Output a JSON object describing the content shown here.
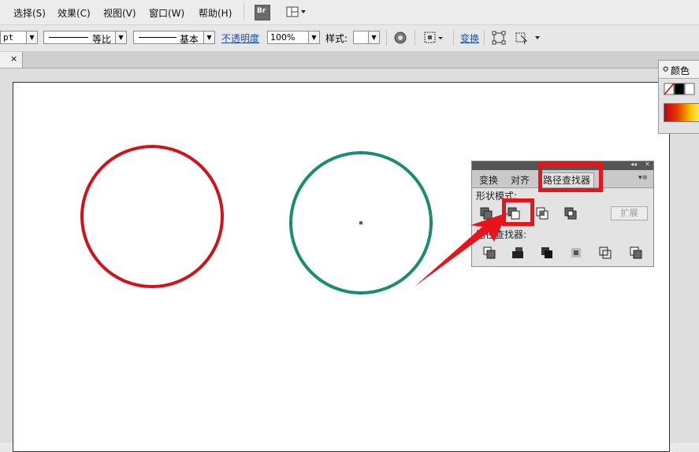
{
  "menu": {
    "items": [
      "选择(S)",
      "效果(C)",
      "视图(V)",
      "窗口(W)",
      "帮助(H)"
    ],
    "bridge_label": "Br"
  },
  "control_bar": {
    "unit": "pt",
    "stroke_profile": "等比",
    "brush": "基本",
    "opacity_label": "不透明度",
    "opacity_value": "100%",
    "style_label": "样式:",
    "transform_link": "变换"
  },
  "tab_strip": {
    "close_glyph": "×"
  },
  "color_panel": {
    "title": "颜色",
    "chevron": "≎"
  },
  "pathfinder_panel": {
    "collapse_glyph": "◂◂",
    "close_glyph": "✕",
    "menu_glyph": "▾≡",
    "tabs": [
      "变换",
      "对齐",
      "路径查找器"
    ],
    "active_tab": "路径查找器",
    "shape_modes_label": "形状模式:",
    "pathfinders_label": "路径查找器:",
    "expand_button": "扩展"
  },
  "canvas": {
    "circle_left_color": "#d0121b",
    "circle_right_color": "#1a8d6c",
    "annotation_color": "#e8141b"
  }
}
